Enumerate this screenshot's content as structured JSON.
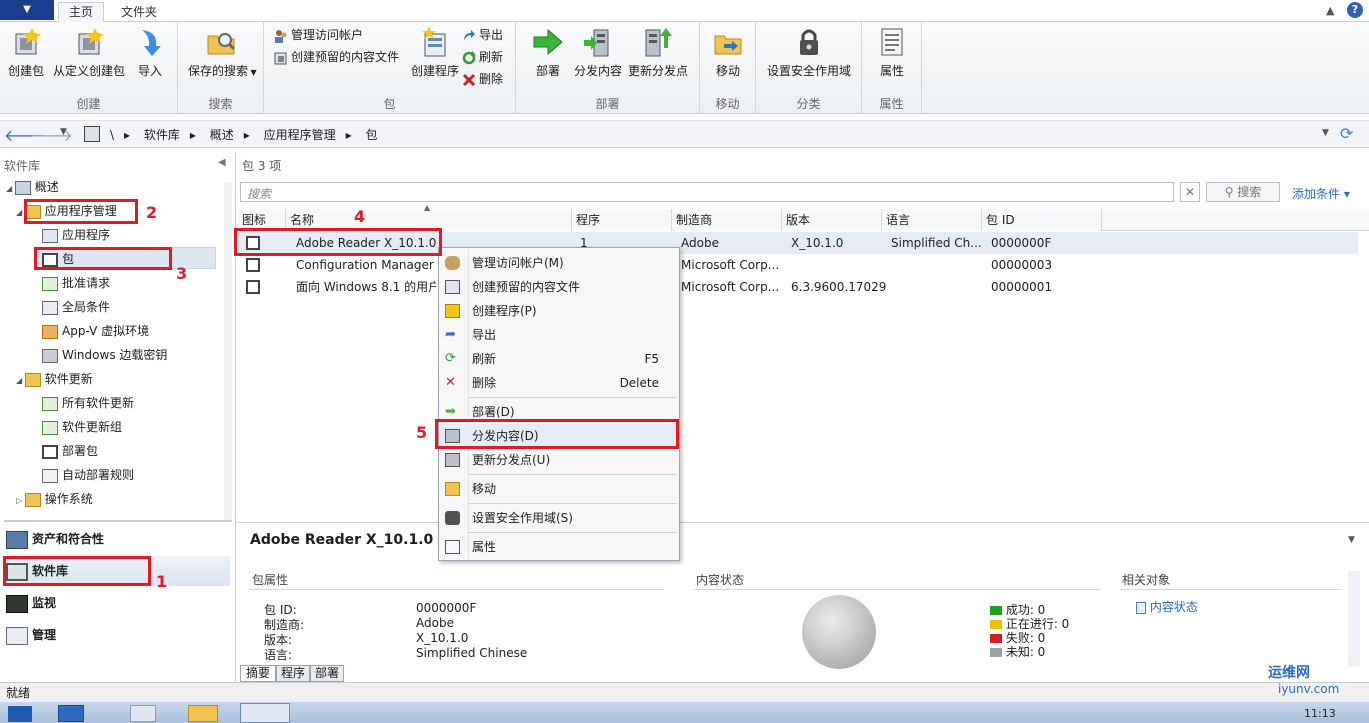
{
  "titlebar": {
    "menu_label": "▼",
    "tabs": [
      "主页",
      "文件夹"
    ],
    "help": "?"
  },
  "ribbon": {
    "groups": [
      {
        "label": "创建",
        "buttons": [
          "创建包",
          "从定义创建包",
          "导入"
        ]
      },
      {
        "label": "搜索",
        "buttons": [
          "保存的搜索"
        ]
      },
      {
        "label": "包",
        "small_buttons": [
          "管理访问帐户",
          "创建预留的内容文件"
        ],
        "buttons": [
          "创建程序"
        ],
        "small_buttons2": [
          "导出",
          "刷新",
          "删除"
        ]
      },
      {
        "label": "部署",
        "buttons": [
          "部署",
          "分发内容",
          "更新分发点"
        ]
      },
      {
        "label": "移动",
        "buttons": [
          "移动"
        ]
      },
      {
        "label": "分类",
        "buttons": [
          "设置安全作用域"
        ]
      },
      {
        "label": "属性",
        "buttons": [
          "属性"
        ]
      }
    ]
  },
  "address": {
    "crumbs": [
      "\\",
      "软件库",
      "概述",
      "应用程序管理",
      "包"
    ]
  },
  "left": {
    "title": "软件库",
    "tree": [
      {
        "label": "概述"
      },
      {
        "label": "应用程序管理"
      },
      {
        "label": "应用程序"
      },
      {
        "label": "包"
      },
      {
        "label": "批准请求"
      },
      {
        "label": "全局条件"
      },
      {
        "label": "App-V 虚拟环境"
      },
      {
        "label": "Windows 边载密钥"
      },
      {
        "label": "软件更新"
      },
      {
        "label": "所有软件更新"
      },
      {
        "label": "软件更新组"
      },
      {
        "label": "部署包"
      },
      {
        "label": "自动部署规则"
      },
      {
        "label": "操作系统"
      }
    ],
    "workspaces": [
      "资产和符合性",
      "软件库",
      "监视",
      "管理"
    ]
  },
  "content": {
    "header": "包 3 项",
    "search_placeholder": "搜索",
    "search_button": "搜索",
    "add_criteria": "添加条件",
    "columns": [
      "图标",
      "名称",
      "程序",
      "制造商",
      "版本",
      "语言",
      "包 ID"
    ],
    "rows": [
      {
        "name": "Adobe Reader X_10.1.0",
        "programs": "1",
        "maker": "Adobe",
        "version": "X_10.1.0",
        "lang": "Simplified Ch...",
        "id": "0000000F"
      },
      {
        "name": "Configuration Manager 客",
        "programs": "",
        "maker": "Microsoft Corp...",
        "version": "",
        "lang": "",
        "id": "00000003"
      },
      {
        "name": "面向 Windows 8.1 的用户",
        "programs": "",
        "maker": "Microsoft Corp...",
        "version": "6.3.9600.17029",
        "lang": "",
        "id": "00000001"
      }
    ]
  },
  "context_menu": {
    "items": [
      {
        "label": "管理访问帐户(M)",
        "shortcut": ""
      },
      {
        "label": "创建预留的内容文件",
        "shortcut": ""
      },
      {
        "label": "创建程序(P)",
        "shortcut": ""
      },
      {
        "label": "导出",
        "shortcut": ""
      },
      {
        "label": "刷新",
        "shortcut": "F5"
      },
      {
        "label": "删除",
        "shortcut": "Delete"
      },
      {
        "label": "部署(D)",
        "shortcut": ""
      },
      {
        "label": "分发内容(D)",
        "shortcut": ""
      },
      {
        "label": "更新分发点(U)",
        "shortcut": ""
      },
      {
        "label": "移动",
        "shortcut": ""
      },
      {
        "label": "设置安全作用域(S)",
        "shortcut": ""
      },
      {
        "label": "属性",
        "shortcut": ""
      }
    ]
  },
  "annotations": [
    "1",
    "2",
    "3",
    "4",
    "5"
  ],
  "details": {
    "title": "Adobe Reader X_10.1.0",
    "section_props": "包属性",
    "section_content": "内容状态",
    "section_related": "相关对象",
    "props": [
      {
        "k": "包 ID:",
        "v": "0000000F"
      },
      {
        "k": "制造商:",
        "v": "Adobe"
      },
      {
        "k": "版本:",
        "v": "X_10.1.0"
      },
      {
        "k": "语言:",
        "v": "Simplified Chinese"
      }
    ],
    "legend": [
      {
        "label": "成功: 0",
        "color": "#1aa31a"
      },
      {
        "label": "正在进行: 0",
        "color": "#e8c200"
      },
      {
        "label": "失败: 0",
        "color": "#d21f1f"
      },
      {
        "label": "未知: 0",
        "color": "#a0a0a0"
      }
    ],
    "related_link": "内容状态",
    "tabs": [
      "摘要",
      "程序",
      "部署"
    ]
  },
  "status": {
    "text": "就绪"
  },
  "taskbar": {
    "clock": "11:13",
    "watermark": "运维网",
    "watermark_url": "iyunv.com"
  }
}
